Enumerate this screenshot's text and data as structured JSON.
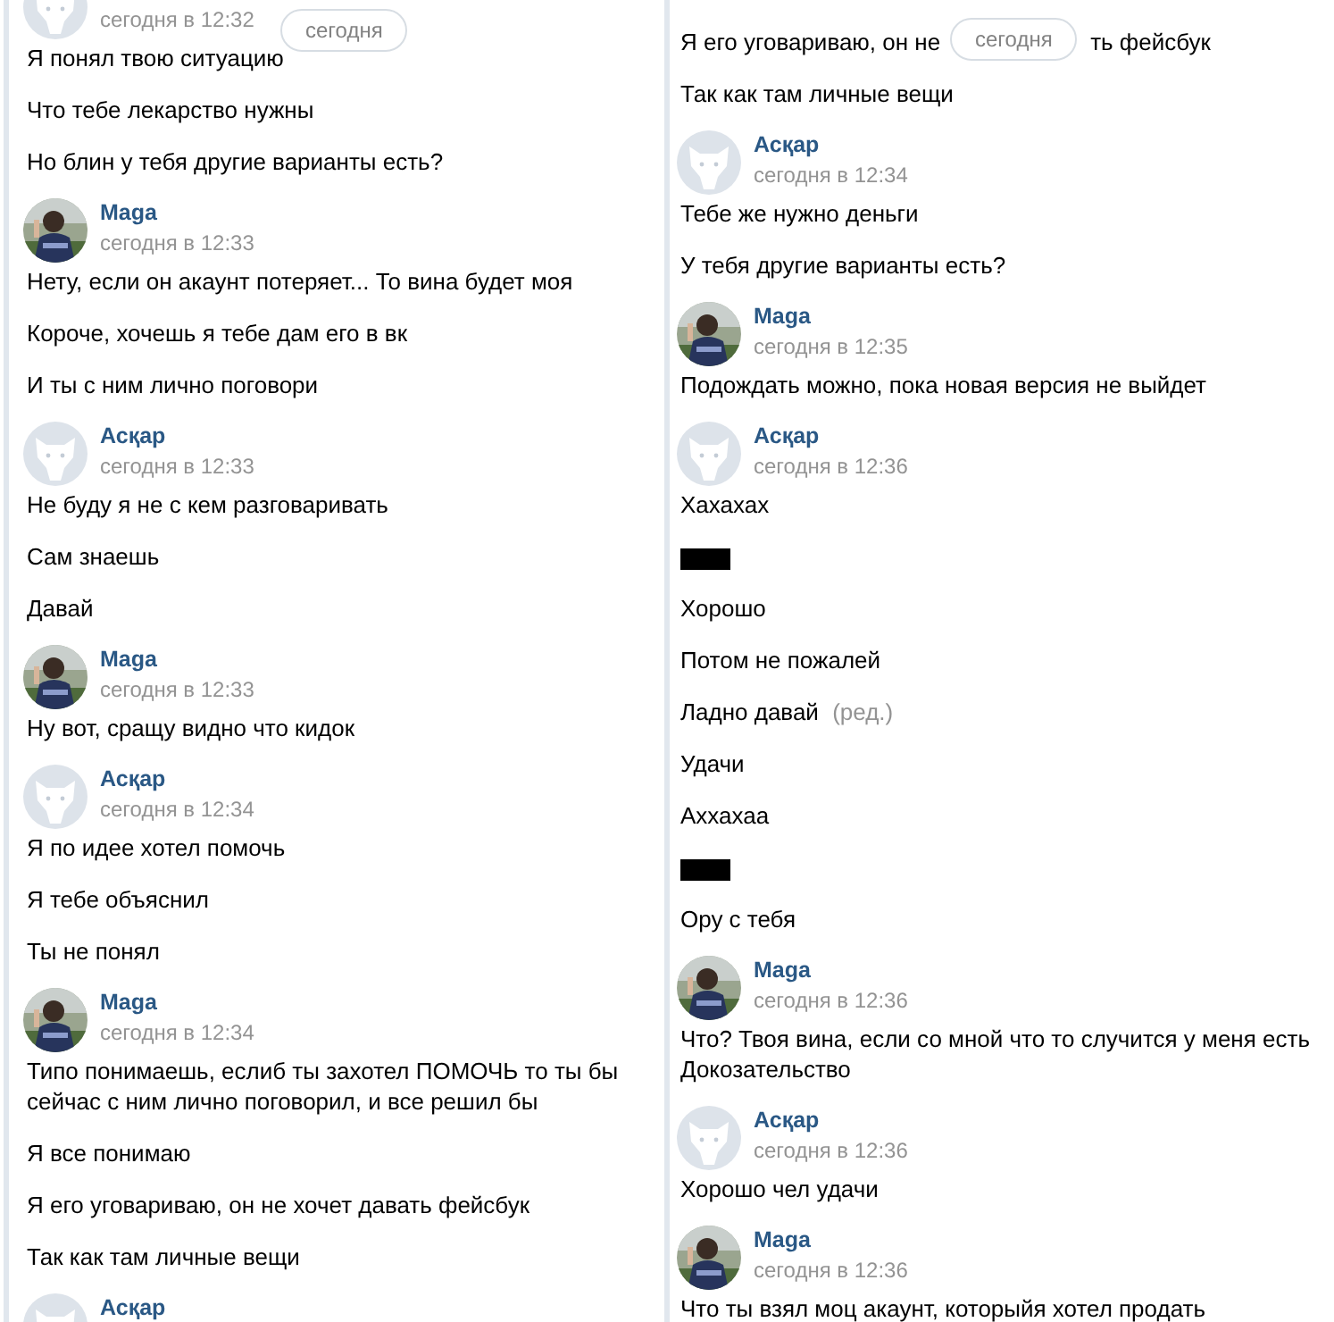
{
  "columns": [
    {
      "date_pill": "сегодня",
      "items": [
        {
          "kind": "header",
          "avatar": {
            "kind": "default"
          },
          "time": "сегодня в 12:32"
        },
        {
          "kind": "message",
          "text": "Я понял твою ситуацию"
        },
        {
          "kind": "message",
          "text": "Что тебе лекарство нужны"
        },
        {
          "kind": "message",
          "text": "Но блин у тебя другие варианты есть?"
        },
        {
          "kind": "header",
          "sender": "Maga",
          "time": "сегодня в 12:33"
        },
        {
          "kind": "message",
          "text": "Нету, если он акаунт потеряет... То вина будет моя"
        },
        {
          "kind": "message",
          "text": "Короче, хочешь я тебе дам его в вк"
        },
        {
          "kind": "message",
          "text": "И ты с ним лично поговори"
        },
        {
          "kind": "header",
          "avatar": {
            "kind": "default"
          },
          "sender": "Асқар",
          "time": "сегодня в 12:33"
        },
        {
          "kind": "message",
          "text": "Не буду я не с кем разговаривать"
        },
        {
          "kind": "message",
          "text": "Сам знаешь"
        },
        {
          "kind": "message",
          "text": "Давай"
        },
        {
          "kind": "header",
          "sender": "Maga",
          "time": "сегодня в 12:33"
        },
        {
          "kind": "message",
          "text": "Ну вот, сращу видно что кидок"
        },
        {
          "kind": "header",
          "avatar": {
            "kind": "default"
          },
          "sender": "Асқар",
          "time": "сегодня в 12:34"
        },
        {
          "kind": "message",
          "text": "Я по идее хотел помочь"
        },
        {
          "kind": "message",
          "text": "Я тебе объяснил"
        },
        {
          "kind": "message",
          "text": "Ты не понял"
        },
        {
          "kind": "header",
          "sender": "Maga",
          "time": "сегодня в 12:34"
        },
        {
          "kind": "message",
          "text": "Типо понимаешь, еслиб ты захотел ПОМОЧЬ то ты бы сейчас с ним лично поговорил, и все решил бы"
        },
        {
          "kind": "message",
          "text": "Я все понимаю"
        },
        {
          "kind": "message",
          "text": "Я его уговариваю, он не хочет давать фейсбук"
        },
        {
          "kind": "message",
          "text": "Так как там личные вещи"
        },
        {
          "kind": "header",
          "avatar": {
            "kind": "default"
          },
          "sender": "Асқар"
        }
      ]
    },
    {
      "date_pill": "сегодня",
      "items": [
        {
          "kind": "message",
          "text": "Я его уговариваю, он не",
          "text_after": "ть фейсбук"
        },
        {
          "kind": "message",
          "text": "Так как там личные вещи"
        },
        {
          "kind": "header",
          "avatar": {
            "kind": "default"
          },
          "sender": "Асқар",
          "time": "сегодня в 12:34"
        },
        {
          "kind": "message",
          "text": "Тебе же нужно деньги"
        },
        {
          "kind": "message",
          "text": "У тебя другие варианты есть?"
        },
        {
          "kind": "header",
          "sender": "Maga",
          "time": "сегодня в 12:35"
        },
        {
          "kind": "message",
          "text": "Подождать можно, пока новая версия не выйдет"
        },
        {
          "kind": "header",
          "avatar": {
            "kind": "default"
          },
          "sender": "Асқар",
          "time": "сегодня в 12:36"
        },
        {
          "kind": "message",
          "text": "Хахахах"
        },
        {
          "kind": "redacted"
        },
        {
          "kind": "message",
          "text": "Хорошо"
        },
        {
          "kind": "message",
          "text": "Потом не пожалей"
        },
        {
          "kind": "message",
          "text": "Ладно давай",
          "edited": "(ред.)"
        },
        {
          "kind": "message",
          "text": "Удачи"
        },
        {
          "kind": "message",
          "text": "Аххахаа"
        },
        {
          "kind": "redacted"
        },
        {
          "kind": "message",
          "text": "Ору с тебя"
        },
        {
          "kind": "header",
          "sender": "Maga",
          "time": "сегодня в 12:36"
        },
        {
          "kind": "message",
          "text": "Что? Твоя вина, если со мной что то случится у меня есть Докозательство"
        },
        {
          "kind": "header",
          "avatar": {
            "kind": "default"
          },
          "sender": "Асқар",
          "time": "сегодня в 12:36"
        },
        {
          "kind": "message",
          "text": "Хорошо чел удачи"
        },
        {
          "kind": "header",
          "sender": "Maga",
          "time": "сегодня в 12:36"
        },
        {
          "kind": "message",
          "text": "Что ты взял моц акаунт, которыйя хотел продать"
        }
      ]
    }
  ]
}
